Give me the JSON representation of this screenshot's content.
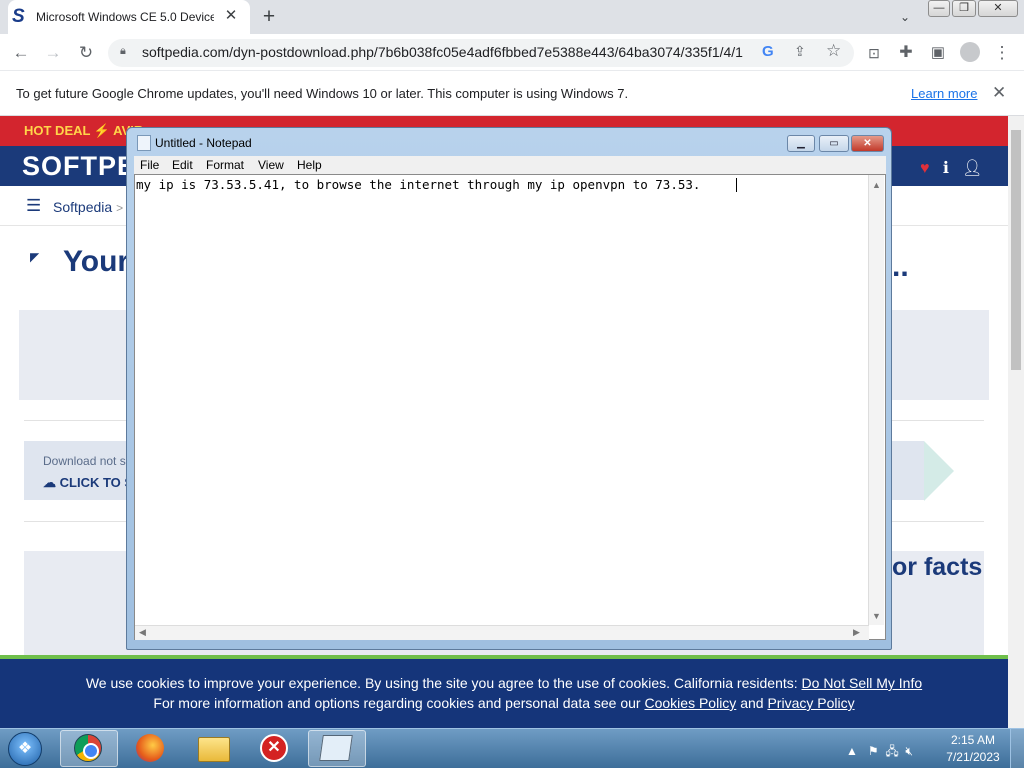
{
  "browser": {
    "tab_title": "Microsoft Windows CE 5.0 Device",
    "url": "softpedia.com/dyn-postdownload.php/7b6b038fc05e4adf6fbbed7e5388e443/64ba3074/335f1/4/1",
    "infobar_text": "To get future Google Chrome updates, you'll need Windows 10 or later. This computer is using Windows 7.",
    "learn_more": "Learn more"
  },
  "page": {
    "hotdeal": "HOT DEAL ⚡ AVIR",
    "logo": "SOFTPE",
    "breadcrumb": "Softpedia",
    "breadcrumb_sep": ">",
    "heading_left": "Your",
    "heading_right": "..",
    "download_note": "Download not s",
    "download_cta": "CLICK TO ST",
    "facts": "or facts"
  },
  "cookie": {
    "line1": "We use cookies to improve your experience. By using the site you agree to the use of cookies. California residents: ",
    "line1_link": "Do Not Sell My Info",
    "line2": "For more information and options regarding cookies and personal data see our ",
    "cookies_policy": "Cookies Policy",
    "and": " and ",
    "privacy_policy": "Privacy Policy"
  },
  "notepad": {
    "title": "Untitled - Notepad",
    "menu": [
      "File",
      "Edit",
      "Format",
      "View",
      "Help"
    ],
    "content": "my ip is 73.53.5.41, to browse the internet through my ip openvpn to 73.53."
  },
  "taskbar": {
    "time": "2:15 AM",
    "date": "7/21/2023"
  }
}
